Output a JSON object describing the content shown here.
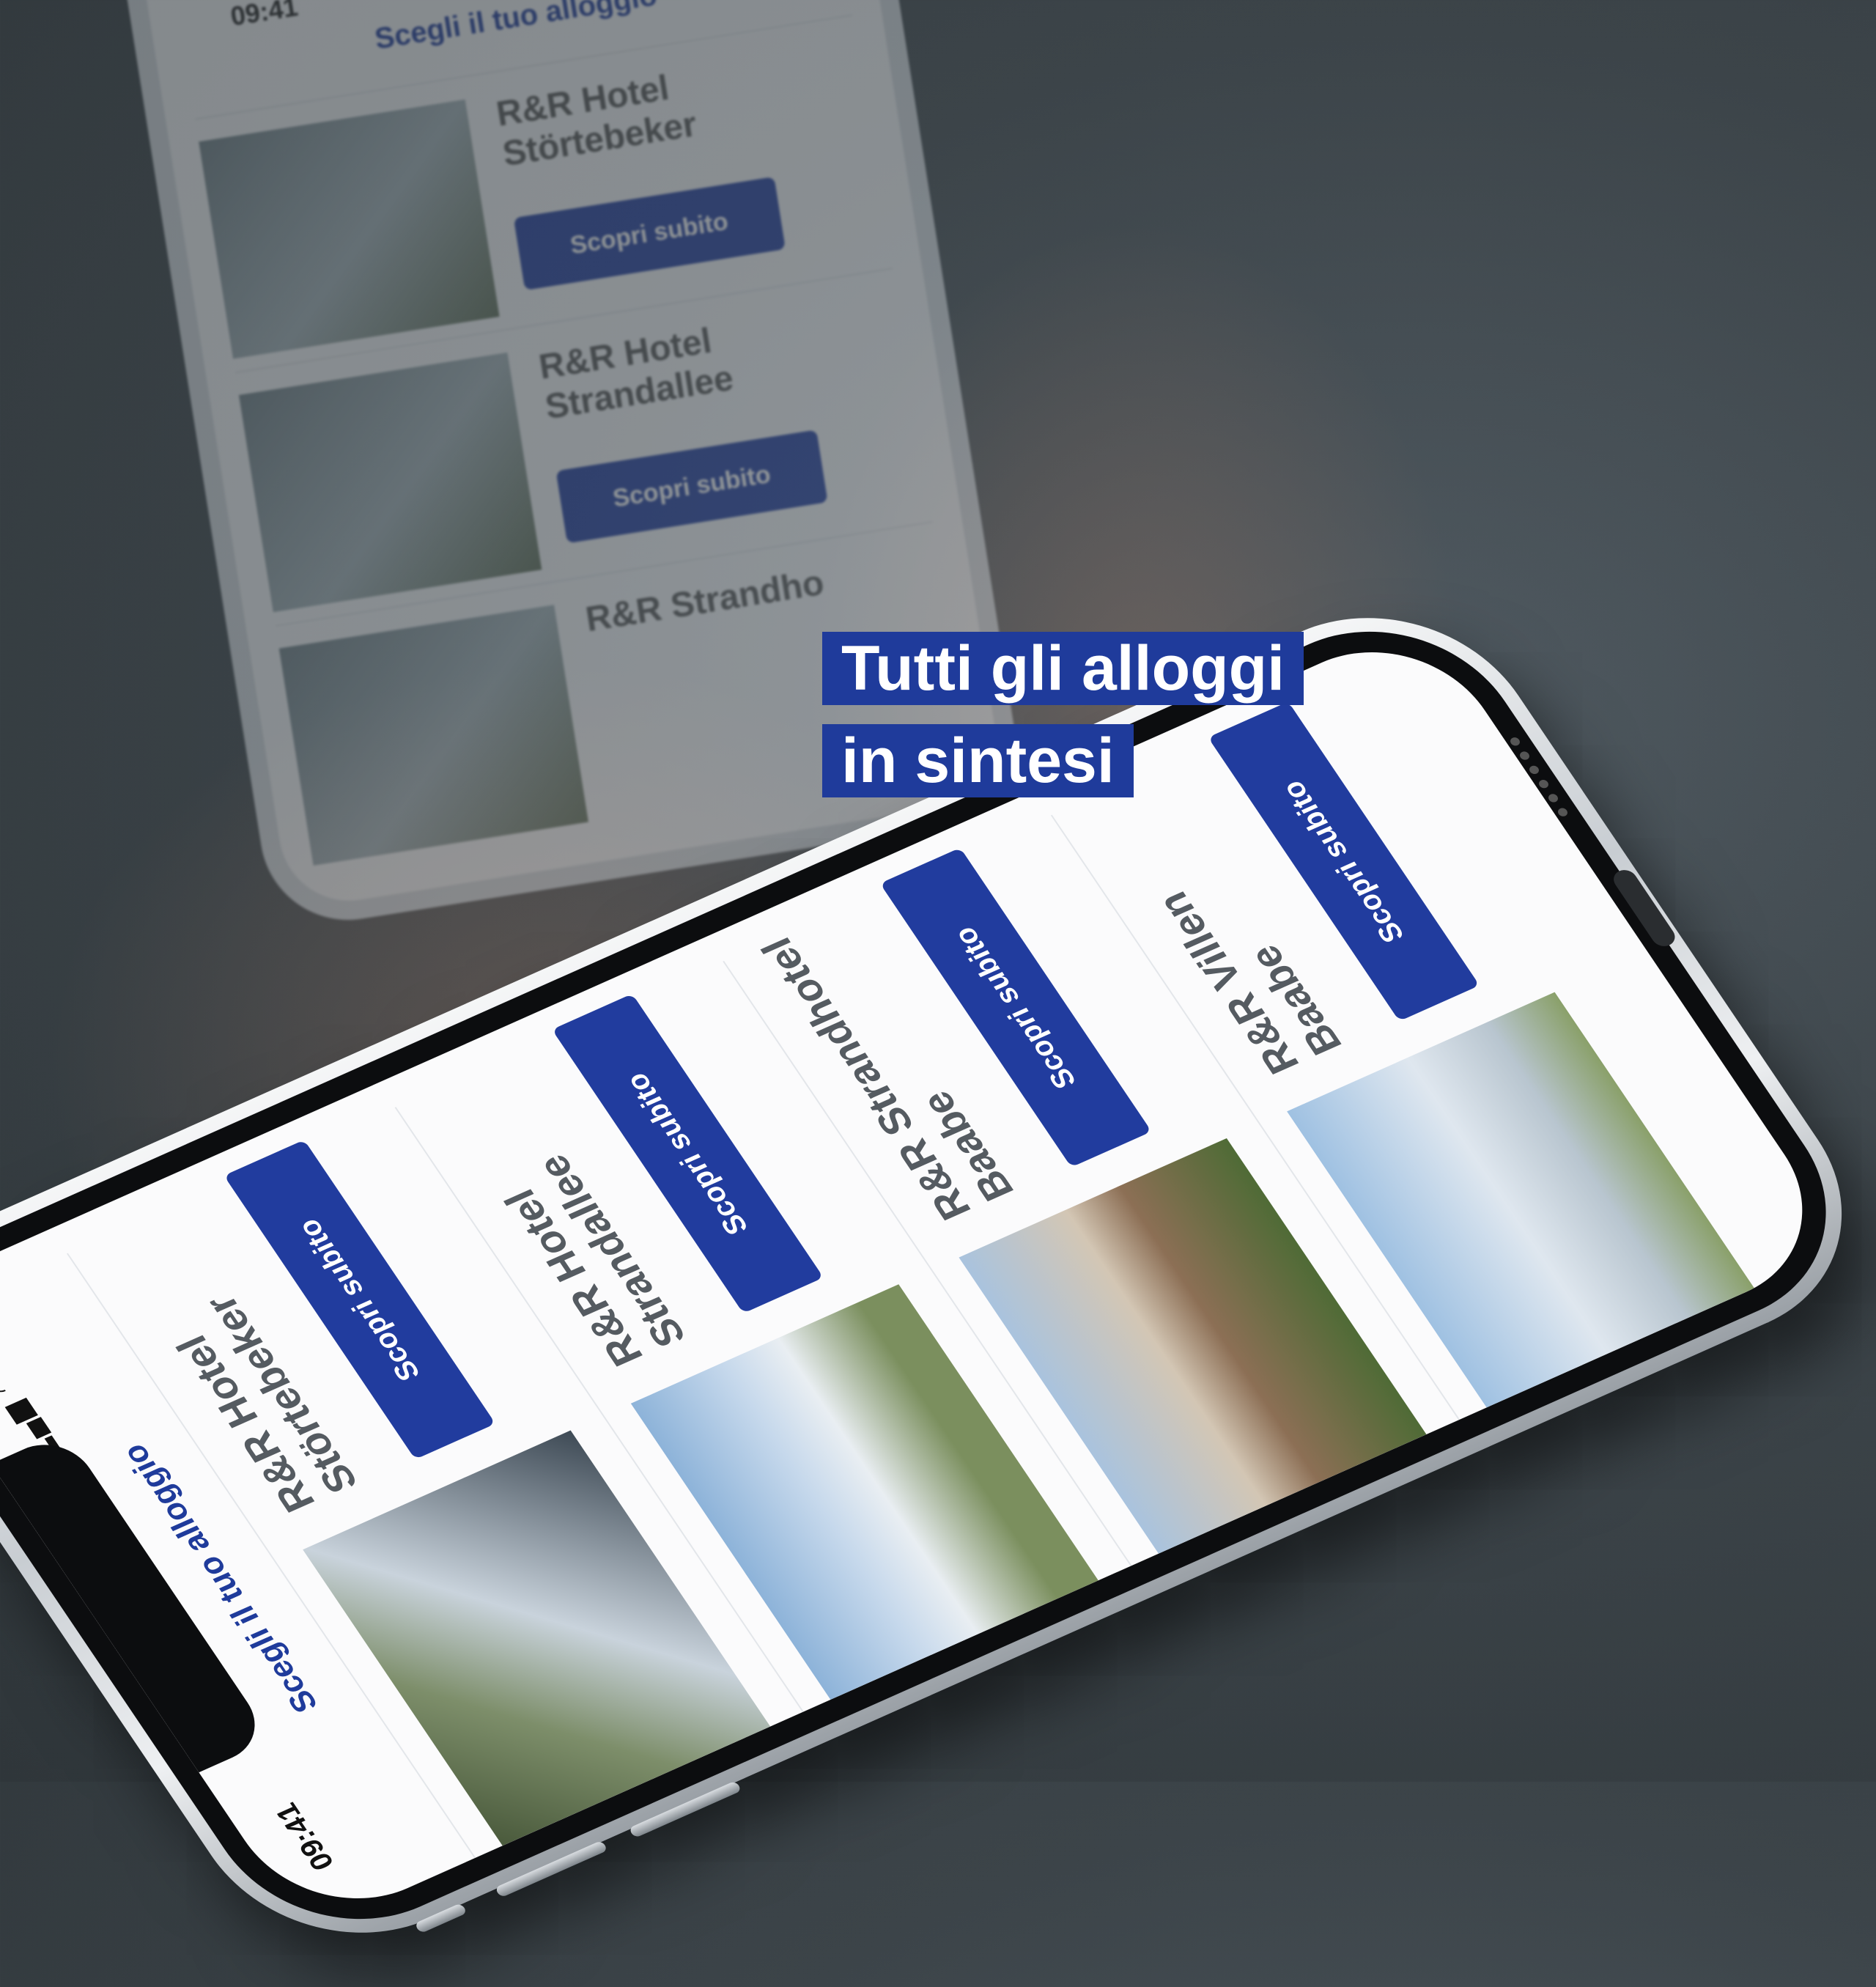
{
  "background_phone": {
    "time": "09:41",
    "status_icons": "▂▄▆ ◠ ▬",
    "title": "Scegli il tuo alloggio",
    "items": [
      {
        "name": "R&R Hotel Störtebeker",
        "button": "Scopri subito"
      },
      {
        "name": "R&R Hotel Strandallee",
        "button": "Scopri subito"
      },
      {
        "name": "R&R Strandho",
        "button": ""
      }
    ]
  },
  "headline": {
    "line1": "Tutti gli alloggi",
    "line2": "in sintesi"
  },
  "phone": {
    "time": "09:41",
    "status_icons": "▂▄▆ ◠ ▬",
    "title": "Scegli il tuo alloggio",
    "items": [
      {
        "name": "R&R Hotel Störtebeker",
        "button": "Scopri subito"
      },
      {
        "name": "R&R Hotel Strandallee",
        "button": "Scopri subito"
      },
      {
        "name": "R&R Strandhotel Baabe",
        "button": "Scopri subito"
      },
      {
        "name": "R&R Villen Baabe",
        "button": "Scopri subito"
      }
    ]
  },
  "colors": {
    "accent": "#213c9e",
    "headline_bg": "#1f3b9b",
    "background": "#3c4449"
  }
}
